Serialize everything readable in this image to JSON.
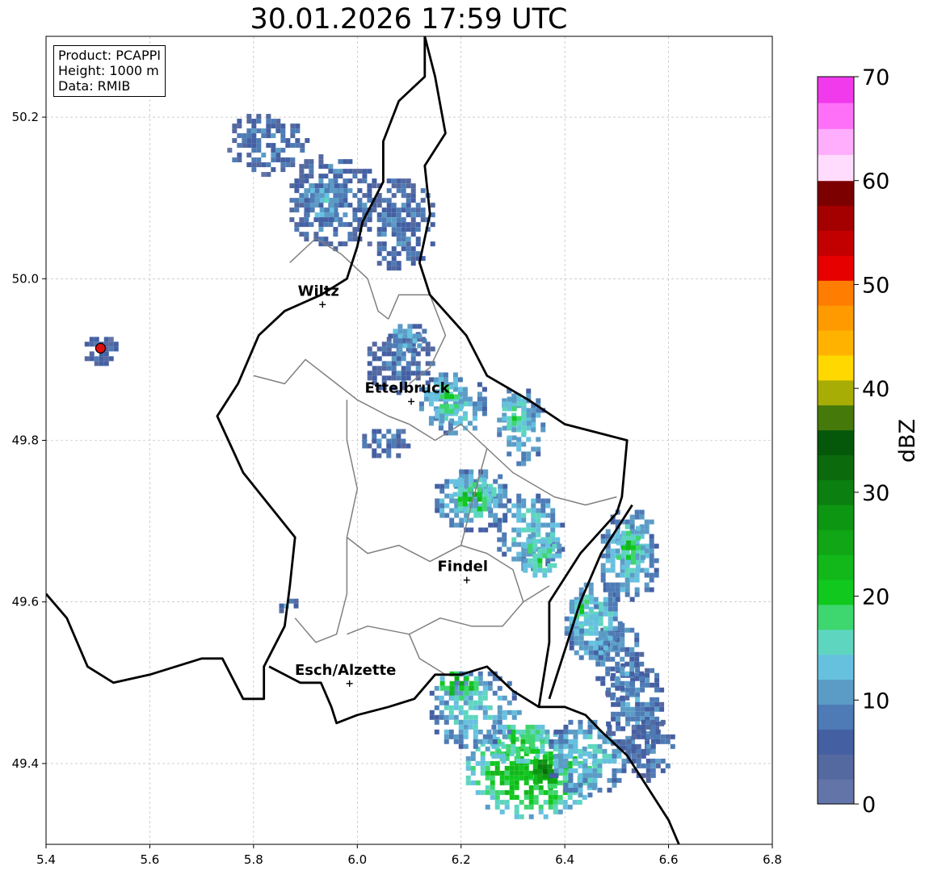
{
  "title": "30.01.2026 17:59 UTC",
  "infobox": {
    "product": "Product: PCAPPI",
    "height": "Height: 1000 m",
    "data": "Data: RMIB"
  },
  "axes": {
    "x_ticks": [
      "5.4",
      "5.6",
      "5.8",
      "6.0",
      "6.2",
      "6.4",
      "6.6",
      "6.8"
    ],
    "y_ticks": [
      "49.4",
      "49.6",
      "49.8",
      "50.0",
      "50.2"
    ],
    "xlim": [
      5.4,
      6.8
    ],
    "ylim": [
      49.3,
      50.3
    ],
    "grid": true
  },
  "cities": [
    {
      "name": "Wiltz",
      "lon": 5.933,
      "lat": 49.968
    },
    {
      "name": "Ettelbruck",
      "lon": 6.104,
      "lat": 49.848
    },
    {
      "name": "Findel",
      "lon": 6.211,
      "lat": 49.627
    },
    {
      "name": "Esch/Alzette",
      "lon": 5.985,
      "lat": 49.499
    }
  ],
  "radar_site": {
    "lon": 5.505,
    "lat": 49.914,
    "color": "#e01010"
  },
  "colorbar": {
    "label": "dBZ",
    "ticks": [
      "0",
      "10",
      "20",
      "30",
      "40",
      "50",
      "60",
      "70"
    ],
    "range": [
      0,
      70
    ],
    "colors": [
      "#6374a8",
      "#54699f",
      "#4460a3",
      "#4e7bb5",
      "#5b9cc6",
      "#66c1df",
      "#5ed6bf",
      "#3ed66e",
      "#10c81e",
      "#12b81a",
      "#10a616",
      "#0d9612",
      "#0b7f10",
      "#0a6a0c",
      "#05580a",
      "#457a0a",
      "#a8ad05",
      "#ffd800",
      "#ffb300",
      "#ff9a00",
      "#ff7d00",
      "#e60000",
      "#c30000",
      "#a40000",
      "#7d0000",
      "#ffdcfd",
      "#ffadfd",
      "#ff70f9",
      "#f03aec"
    ]
  },
  "radar_cells": [
    {
      "lon": 6.33,
      "lat": 49.39,
      "rlon": 0.13,
      "rlat": 0.055,
      "dbz": 22
    },
    {
      "lon": 6.36,
      "lat": 49.395,
      "rlon": 0.04,
      "rlat": 0.022,
      "dbz": 30
    },
    {
      "lon": 6.31,
      "lat": 49.43,
      "rlon": 0.07,
      "rlat": 0.03,
      "dbz": 20
    },
    {
      "lon": 6.44,
      "lat": 49.41,
      "rlon": 0.08,
      "rlat": 0.05,
      "dbz": 14
    },
    {
      "lon": 6.22,
      "lat": 49.47,
      "rlon": 0.09,
      "rlat": 0.05,
      "dbz": 14
    },
    {
      "lon": 6.19,
      "lat": 49.5,
      "rlon": 0.04,
      "rlat": 0.02,
      "dbz": 24
    },
    {
      "lon": 6.53,
      "lat": 49.47,
      "rlon": 0.06,
      "rlat": 0.06,
      "dbz": 10
    },
    {
      "lon": 6.56,
      "lat": 49.42,
      "rlon": 0.05,
      "rlat": 0.04,
      "dbz": 8
    },
    {
      "lon": 6.5,
      "lat": 49.53,
      "rlon": 0.05,
      "rlat": 0.05,
      "dbz": 10
    },
    {
      "lon": 6.45,
      "lat": 49.58,
      "rlon": 0.06,
      "rlat": 0.05,
      "dbz": 14
    },
    {
      "lon": 6.43,
      "lat": 49.59,
      "rlon": 0.03,
      "rlat": 0.025,
      "dbz": 18
    },
    {
      "lon": 6.52,
      "lat": 49.66,
      "rlon": 0.06,
      "rlat": 0.06,
      "dbz": 14
    },
    {
      "lon": 6.52,
      "lat": 49.67,
      "rlon": 0.03,
      "rlat": 0.03,
      "dbz": 20
    },
    {
      "lon": 6.33,
      "lat": 49.69,
      "rlon": 0.07,
      "rlat": 0.05,
      "dbz": 14
    },
    {
      "lon": 6.35,
      "lat": 49.66,
      "rlon": 0.04,
      "rlat": 0.03,
      "dbz": 18
    },
    {
      "lon": 6.22,
      "lat": 49.73,
      "rlon": 0.08,
      "rlat": 0.04,
      "dbz": 14
    },
    {
      "lon": 6.22,
      "lat": 49.735,
      "rlon": 0.045,
      "rlat": 0.025,
      "dbz": 22
    },
    {
      "lon": 6.18,
      "lat": 49.85,
      "rlon": 0.07,
      "rlat": 0.04,
      "dbz": 14
    },
    {
      "lon": 6.17,
      "lat": 49.85,
      "rlon": 0.03,
      "rlat": 0.025,
      "dbz": 20
    },
    {
      "lon": 6.31,
      "lat": 49.82,
      "rlon": 0.05,
      "rlat": 0.05,
      "dbz": 14
    },
    {
      "lon": 6.3,
      "lat": 49.83,
      "rlon": 0.03,
      "rlat": 0.03,
      "dbz": 18
    },
    {
      "lon": 6.05,
      "lat": 49.8,
      "rlon": 0.05,
      "rlat": 0.02,
      "dbz": 8
    },
    {
      "lon": 6.08,
      "lat": 49.9,
      "rlon": 0.07,
      "rlat": 0.04,
      "dbz": 8
    },
    {
      "lon": 6.09,
      "lat": 49.93,
      "rlon": 0.04,
      "rlat": 0.02,
      "dbz": 12
    },
    {
      "lon": 5.82,
      "lat": 50.17,
      "rlon": 0.08,
      "rlat": 0.04,
      "dbz": 8
    },
    {
      "lon": 5.95,
      "lat": 50.1,
      "rlon": 0.09,
      "rlat": 0.06,
      "dbz": 9
    },
    {
      "lon": 6.08,
      "lat": 50.07,
      "rlon": 0.07,
      "rlat": 0.06,
      "dbz": 8
    },
    {
      "lon": 5.93,
      "lat": 50.1,
      "rlon": 0.04,
      "rlat": 0.03,
      "dbz": 13
    },
    {
      "lon": 5.86,
      "lat": 49.6,
      "rlon": 0.02,
      "rlat": 0.01,
      "dbz": 10
    },
    {
      "lon": 5.505,
      "lat": 49.914,
      "rlon": 0.04,
      "rlat": 0.02,
      "dbz": 6
    }
  ],
  "country_borders": [
    [
      [
        6.13,
        50.3
      ],
      [
        6.13,
        50.25
      ],
      [
        6.08,
        50.22
      ],
      [
        6.05,
        50.17
      ],
      [
        6.05,
        50.12
      ],
      [
        6.01,
        50.07
      ],
      [
        6.0,
        50.04
      ],
      [
        5.98,
        50.0
      ],
      [
        5.93,
        49.98
      ],
      [
        5.86,
        49.96
      ],
      [
        5.81,
        49.93
      ],
      [
        5.77,
        49.87
      ],
      [
        5.73,
        49.83
      ],
      [
        5.78,
        49.76
      ],
      [
        5.83,
        49.72
      ],
      [
        5.88,
        49.68
      ],
      [
        5.87,
        49.62
      ],
      [
        5.86,
        49.57
      ],
      [
        5.82,
        49.52
      ],
      [
        5.82,
        49.48
      ],
      [
        5.78,
        49.48
      ],
      [
        5.74,
        49.53
      ],
      [
        5.7,
        49.53
      ],
      [
        5.65,
        49.52
      ],
      [
        5.6,
        49.51
      ],
      [
        5.53,
        49.5
      ],
      [
        5.48,
        49.52
      ],
      [
        5.44,
        49.58
      ],
      [
        5.4,
        49.61
      ]
    ],
    [
      [
        6.13,
        50.3
      ],
      [
        6.15,
        50.25
      ],
      [
        6.17,
        50.18
      ],
      [
        6.13,
        50.14
      ],
      [
        6.14,
        50.08
      ],
      [
        6.12,
        50.02
      ],
      [
        6.14,
        49.98
      ],
      [
        6.21,
        49.93
      ],
      [
        6.25,
        49.88
      ],
      [
        6.33,
        49.85
      ],
      [
        6.4,
        49.82
      ],
      [
        6.46,
        49.81
      ],
      [
        6.52,
        49.8
      ],
      [
        6.51,
        49.73
      ],
      [
        6.5,
        49.71
      ],
      [
        6.43,
        49.66
      ],
      [
        6.37,
        49.6
      ],
      [
        6.37,
        49.55
      ],
      [
        6.35,
        49.47
      ],
      [
        6.4,
        49.47
      ],
      [
        6.44,
        49.46
      ],
      [
        6.47,
        49.44
      ],
      [
        6.52,
        49.41
      ],
      [
        6.58,
        49.35
      ],
      [
        6.6,
        49.33
      ],
      [
        6.62,
        49.3
      ]
    ],
    [
      [
        6.06,
        49.47
      ],
      [
        6.0,
        49.46
      ],
      [
        5.96,
        49.45
      ],
      [
        5.95,
        49.47
      ],
      [
        5.93,
        49.5
      ],
      [
        5.89,
        49.5
      ],
      [
        5.83,
        49.52
      ]
    ],
    [
      [
        6.06,
        49.47
      ],
      [
        6.11,
        49.48
      ],
      [
        6.15,
        49.51
      ],
      [
        6.2,
        49.51
      ],
      [
        6.25,
        49.52
      ],
      [
        6.3,
        49.49
      ],
      [
        6.35,
        49.47
      ]
    ],
    [
      [
        6.37,
        49.48
      ],
      [
        6.43,
        49.6
      ],
      [
        6.47,
        49.66
      ],
      [
        6.53,
        49.72
      ]
    ]
  ],
  "district_borders": [
    [
      [
        5.87,
        50.02
      ],
      [
        5.92,
        50.05
      ],
      [
        5.97,
        50.03
      ],
      [
        6.02,
        50.0
      ],
      [
        6.04,
        49.96
      ],
      [
        6.06,
        49.95
      ]
    ],
    [
      [
        5.8,
        49.88
      ],
      [
        5.86,
        49.87
      ],
      [
        5.9,
        49.9
      ],
      [
        5.96,
        49.87
      ],
      [
        6.0,
        49.85
      ],
      [
        6.06,
        49.83
      ],
      [
        6.1,
        49.82
      ]
    ],
    [
      [
        6.06,
        49.95
      ],
      [
        6.08,
        49.98
      ],
      [
        6.14,
        49.98
      ],
      [
        6.17,
        49.93
      ],
      [
        6.14,
        49.89
      ],
      [
        6.1,
        49.87
      ]
    ],
    [
      [
        5.98,
        49.85
      ],
      [
        5.98,
        49.8
      ],
      [
        6.0,
        49.74
      ],
      [
        5.98,
        49.68
      ],
      [
        5.98,
        49.61
      ],
      [
        5.96,
        49.56
      ],
      [
        5.92,
        49.55
      ],
      [
        5.88,
        49.58
      ]
    ],
    [
      [
        6.1,
        49.82
      ],
      [
        6.15,
        49.8
      ],
      [
        6.2,
        49.82
      ],
      [
        6.25,
        49.79
      ],
      [
        6.22,
        49.72
      ],
      [
        6.2,
        49.67
      ],
      [
        6.14,
        49.65
      ],
      [
        6.08,
        49.67
      ],
      [
        6.02,
        49.66
      ],
      [
        5.98,
        49.68
      ]
    ],
    [
      [
        6.25,
        49.79
      ],
      [
        6.3,
        49.76
      ],
      [
        6.38,
        49.73
      ],
      [
        6.44,
        49.72
      ],
      [
        6.5,
        49.73
      ]
    ],
    [
      [
        6.2,
        49.67
      ],
      [
        6.25,
        49.66
      ],
      [
        6.3,
        49.64
      ],
      [
        6.32,
        49.6
      ],
      [
        6.28,
        49.57
      ],
      [
        6.22,
        49.57
      ],
      [
        6.16,
        49.58
      ],
      [
        6.1,
        49.56
      ],
      [
        6.02,
        49.57
      ],
      [
        5.98,
        49.56
      ]
    ],
    [
      [
        6.1,
        49.56
      ],
      [
        6.12,
        49.53
      ],
      [
        6.17,
        49.51
      ]
    ],
    [
      [
        6.32,
        49.6
      ],
      [
        6.37,
        49.62
      ]
    ]
  ],
  "colors": {
    "country_border": "#000000",
    "district_border": "#808080",
    "grid": "#b0b0b0"
  }
}
